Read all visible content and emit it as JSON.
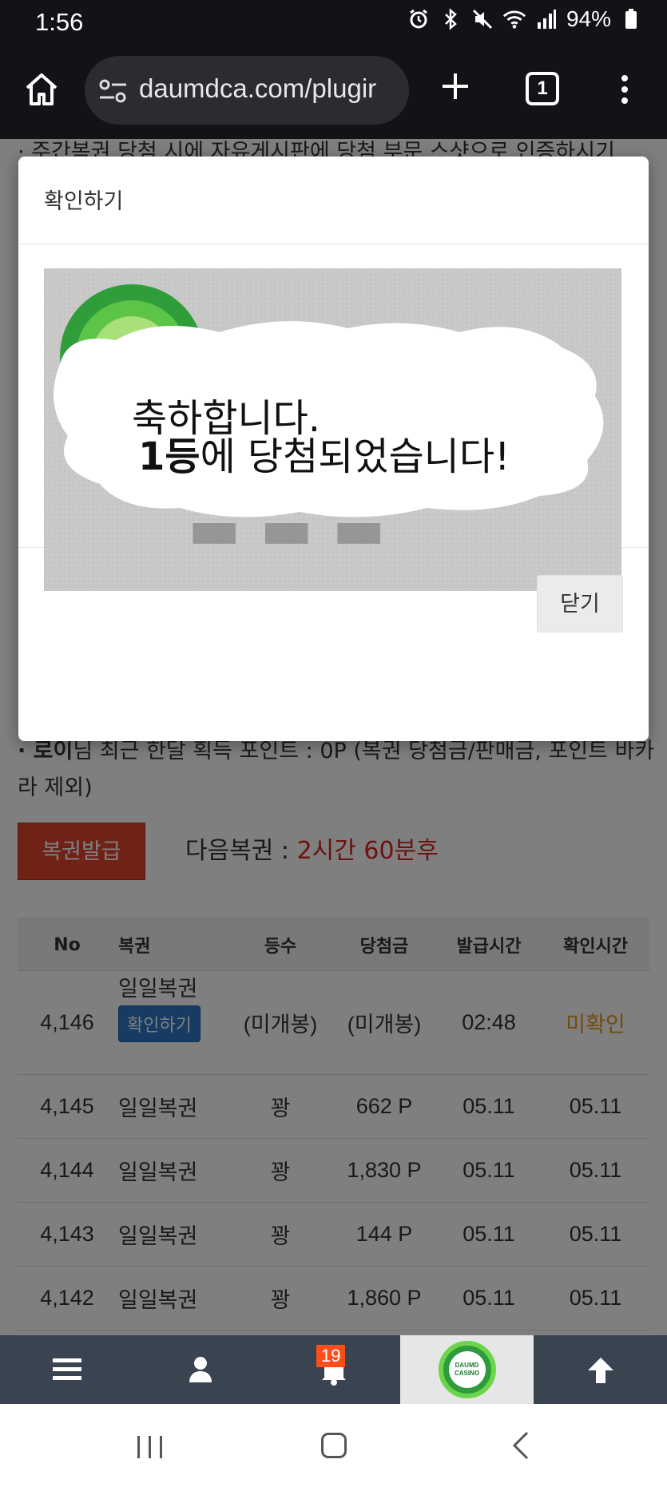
{
  "status_bar": {
    "time": "1:56",
    "battery": "94%",
    "icons": [
      "alarm-icon",
      "bluetooth-icon",
      "mute-icon",
      "wifi-icon",
      "signal-icon",
      "battery-icon"
    ]
  },
  "browser": {
    "url": "daumdca.com/plugir",
    "tab_count": "1"
  },
  "page": {
    "top_notice": "· 주간복권 당첨 시에 자유게시판에 당첨 부문 스샷으로 인증하시기",
    "points_line_user": "· 로이",
    "points_line_rest": "님 최근 한달 획득 포인트 : 0P (복권 당첨금/판매금, 포인트 바카라 제외)",
    "issue_button": "복권발급",
    "next_lotto_label": "다음복권 : ",
    "next_lotto_value": "2시간 60분후",
    "table": {
      "headers": [
        "No",
        "복권",
        "등수",
        "당첨금",
        "발급시간",
        "확인시간"
      ],
      "rows": [
        {
          "no": "4,146",
          "lotto": "일일복권",
          "confirm_button": "확인하기",
          "rank": "(미개봉)",
          "prize": "(미개봉)",
          "issued": "02:48",
          "checked": "미확인"
        },
        {
          "no": "4,145",
          "lotto": "일일복권",
          "rank": "꽝",
          "prize": "662 P",
          "issued": "05.11",
          "checked": "05.11"
        },
        {
          "no": "4,144",
          "lotto": "일일복권",
          "rank": "꽝",
          "prize": "1,830 P",
          "issued": "05.11",
          "checked": "05.11"
        },
        {
          "no": "4,143",
          "lotto": "일일복권",
          "rank": "꽝",
          "prize": "144 P",
          "issued": "05.11",
          "checked": "05.11"
        },
        {
          "no": "4,142",
          "lotto": "일일복권",
          "rank": "꽝",
          "prize": "1,860 P",
          "issued": "05.11",
          "checked": "05.11"
        }
      ]
    }
  },
  "modal": {
    "title": "확인하기",
    "prize_line1": "축하합니다.",
    "prize_line2_bold": "1등",
    "prize_line2_rest": "에 당첨되었습니다!",
    "close_button": "닫기"
  },
  "bottom_nav": {
    "notification_count": "19",
    "logo_text_1": "DAUMD",
    "logo_text_2": "CASINO"
  },
  "colors": {
    "accent_red": "#e0452f",
    "countdown_red": "#d9231c",
    "unconfirmed_orange": "#e39a1c",
    "confirm_blue": "#2d78c7",
    "nav_bg": "#3a4350"
  }
}
